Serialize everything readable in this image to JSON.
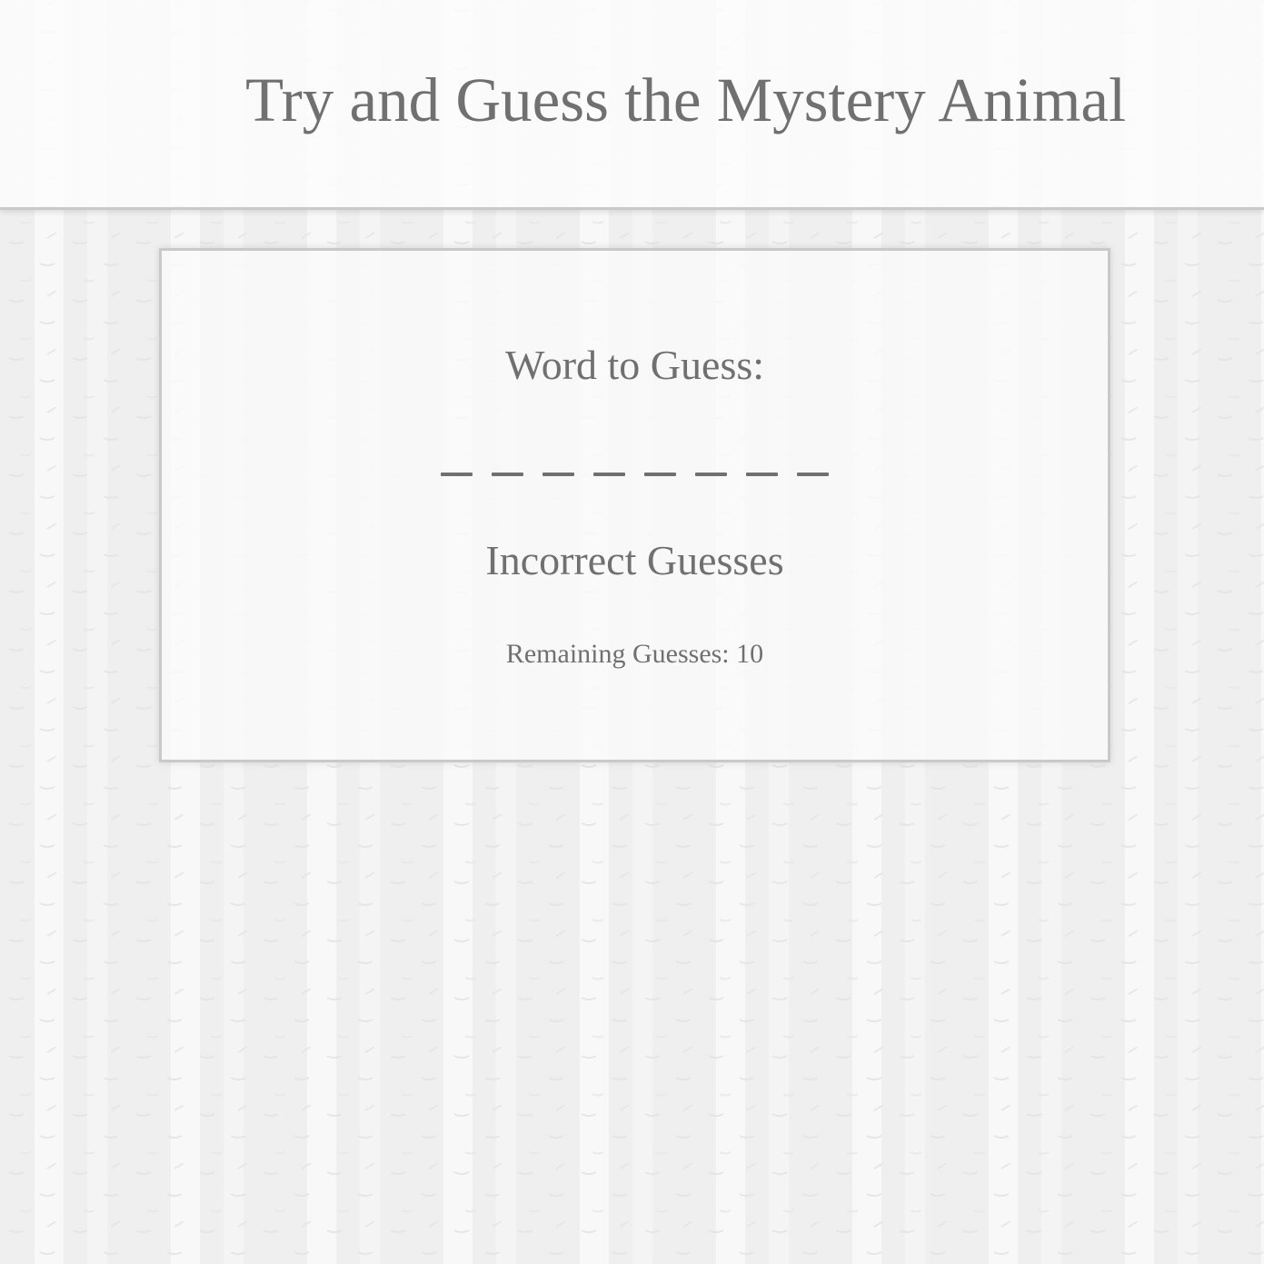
{
  "header": {
    "title": "Try and Guess the Mystery Animal"
  },
  "game": {
    "word_label": "Word to Guess:",
    "blank_count": 8,
    "revealed_letters": [
      "",
      "",
      "",
      "",
      "",
      "",
      "",
      ""
    ],
    "incorrect_label": "Incorrect Guesses",
    "incorrect_letters": [],
    "remaining_label": "Remaining Guesses: 10",
    "remaining_count": 10
  },
  "colors": {
    "text": "#707070",
    "background": "#efefef",
    "panel_border": "#c9c9c9"
  }
}
